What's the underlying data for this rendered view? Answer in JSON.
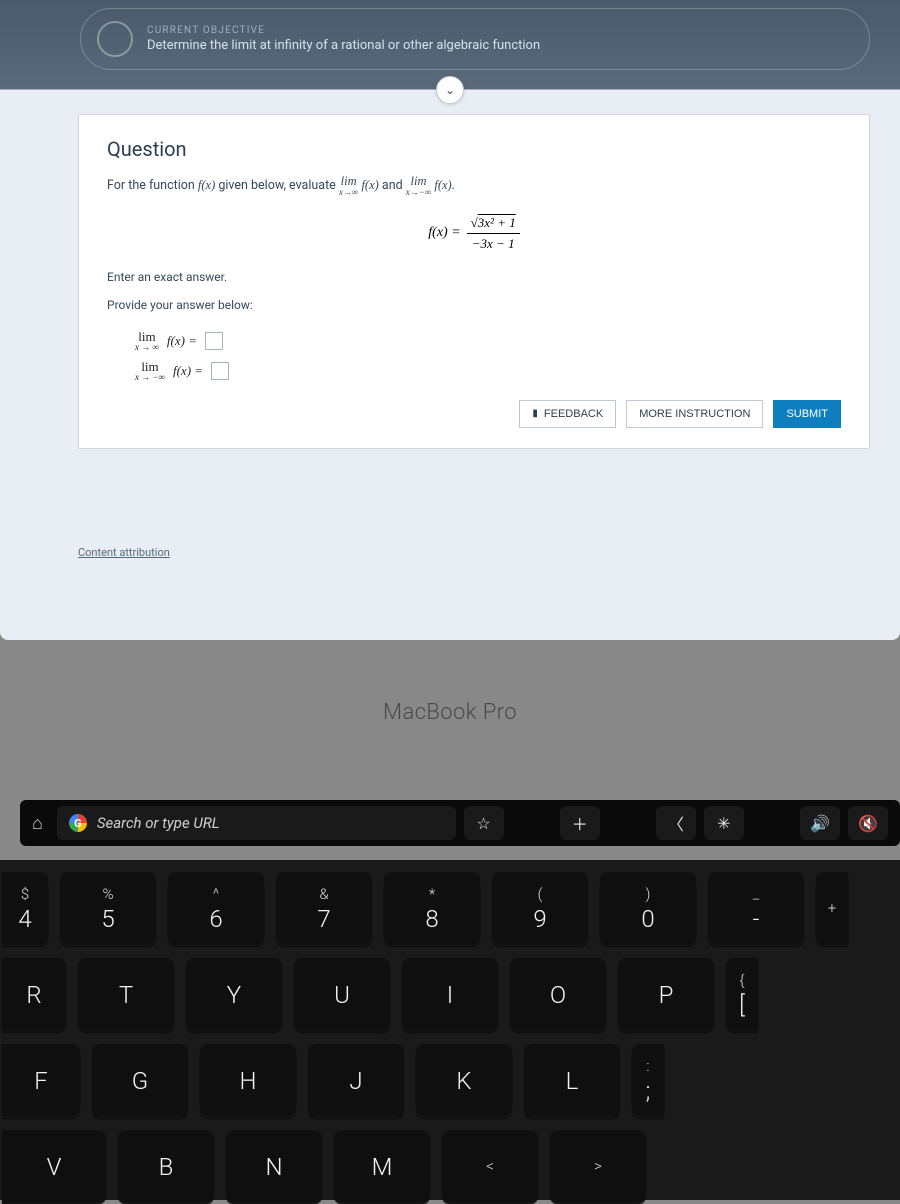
{
  "header": {
    "objective_label": "CURRENT OBJECTIVE",
    "objective_text": "Determine the limit at infinity of a rational or other algebraic function"
  },
  "question": {
    "title": "Question",
    "prompt_prefix": "For the function ",
    "prompt_fx": "f(x)",
    "prompt_mid": " given below, evaluate ",
    "lim1_top": "lim",
    "lim1_bot": "x→∞",
    "lim1_fx": "f(x)",
    "prompt_and": " and ",
    "lim2_top": "lim",
    "lim2_bot": "x→−∞",
    "lim2_fx": "f(x).",
    "formula_lhs": "f(x) =",
    "formula_num": "3x² + 1",
    "formula_den": "−3x − 1",
    "enter_exact": "Enter an exact answer.",
    "provide": "Provide your answer below:",
    "ans1_lim_top": "lim",
    "ans1_lim_bot": "x → ∞",
    "ans1_fx": "f(x) =",
    "ans2_lim_top": "lim",
    "ans2_lim_bot": "x → −∞",
    "ans2_fx": "f(x) =",
    "buttons": {
      "feedback": "FEEDBACK",
      "more": "MORE INSTRUCTION",
      "submit": "SUBMIT"
    },
    "attribution": "Content attribution"
  },
  "bezel": "MacBook Pro",
  "touchbar": {
    "search_placeholder": "Search or type URL",
    "star": "☆",
    "plus": "＋",
    "back": "〈",
    "brightness": "✳",
    "volume": "🔊",
    "mute": "🔇",
    "home": "⌂"
  },
  "keys": {
    "row1": [
      {
        "upper": "$",
        "lower": "4"
      },
      {
        "upper": "%",
        "lower": "5"
      },
      {
        "upper": "^",
        "lower": "6"
      },
      {
        "upper": "&",
        "lower": "7"
      },
      {
        "upper": "*",
        "lower": "8"
      },
      {
        "upper": "(",
        "lower": "9"
      },
      {
        "upper": ")",
        "lower": "0"
      },
      {
        "upper": "_",
        "lower": "-"
      },
      {
        "upper": "+",
        "lower": ""
      }
    ],
    "row2": [
      "R",
      "T",
      "Y",
      "U",
      "I",
      "O",
      "P"
    ],
    "row2_edge_upper": "{",
    "row2_edge_lower": "[",
    "row3": [
      "F",
      "G",
      "H",
      "J",
      "K",
      "L"
    ],
    "row3_edge_upper": ":",
    "row3_edge_lower": ";",
    "row4": [
      "V",
      "B",
      "N",
      "M"
    ],
    "row4_sym1_upper": "<",
    "row4_sym2_upper": ">"
  }
}
